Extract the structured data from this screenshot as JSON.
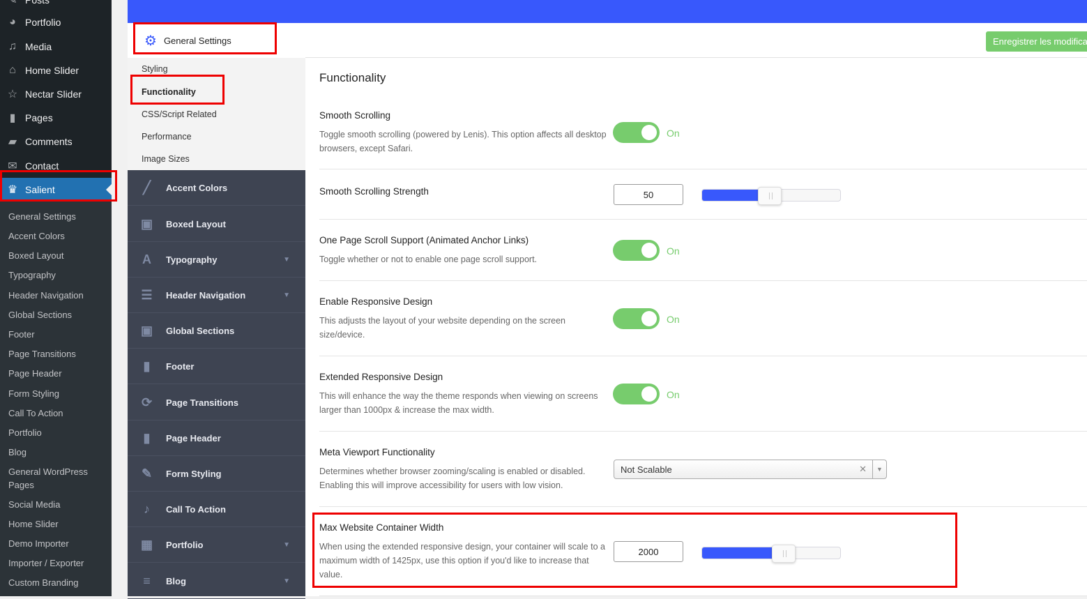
{
  "wp_menu": {
    "items": [
      {
        "label": "Posts",
        "icon": "pin-icon"
      },
      {
        "label": "Portfolio",
        "icon": "palette-icon"
      },
      {
        "label": "Media",
        "icon": "media-icon"
      },
      {
        "label": "Home Slider",
        "icon": "home-icon"
      },
      {
        "label": "Nectar Slider",
        "icon": "star-icon"
      },
      {
        "label": "Pages",
        "icon": "pages-icon"
      },
      {
        "label": "Comments",
        "icon": "comment-icon"
      },
      {
        "label": "Contact",
        "icon": "mail-icon"
      },
      {
        "label": "Salient",
        "icon": "crown-icon",
        "active": true
      }
    ],
    "submenu": [
      "General Settings",
      "Accent Colors",
      "Boxed Layout",
      "Typography",
      "Header Navigation",
      "Global Sections",
      "Footer",
      "Page Transitions",
      "Page Header",
      "Form Styling",
      "Call To Action",
      "Portfolio",
      "Blog",
      "General WordPress Pages",
      "Social Media",
      "Home Slider",
      "Demo Importer",
      "Importer / Exporter",
      "Custom Branding"
    ]
  },
  "options_panel": {
    "section_header": "General Settings",
    "section_sub": [
      "Styling",
      "Functionality",
      "CSS/Script Related",
      "Performance",
      "Image Sizes"
    ],
    "active_sub": "Functionality",
    "nav": [
      {
        "label": "Accent Colors",
        "icon": "brush-icon"
      },
      {
        "label": "Boxed Layout",
        "icon": "layout-icon"
      },
      {
        "label": "Typography",
        "icon": "font-icon",
        "expandable": true
      },
      {
        "label": "Header Navigation",
        "icon": "menu-icon",
        "expandable": true
      },
      {
        "label": "Global Sections",
        "icon": "layout-icon"
      },
      {
        "label": "Footer",
        "icon": "file-icon"
      },
      {
        "label": "Page Transitions",
        "icon": "refresh-icon"
      },
      {
        "label": "Page Header",
        "icon": "file-icon"
      },
      {
        "label": "Form Styling",
        "icon": "edit-icon"
      },
      {
        "label": "Call To Action",
        "icon": "bell-icon"
      },
      {
        "label": "Portfolio",
        "icon": "grid-icon",
        "expandable": true
      },
      {
        "label": "Blog",
        "icon": "list-icon",
        "expandable": true
      }
    ]
  },
  "main": {
    "save_button": "Enregistrer les modifications",
    "title": "Functionality",
    "settings": {
      "smooth_scrolling": {
        "label": "Smooth Scrolling",
        "desc": "Toggle smooth scrolling (powered by Lenis). This option affects all desktop browsers, except Safari.",
        "state": "On"
      },
      "smooth_strength": {
        "label": "Smooth Scrolling Strength",
        "value": "50",
        "slider_fraction": 0.49
      },
      "one_page": {
        "label": "One Page Scroll Support (Animated Anchor Links)",
        "desc": "Toggle whether or not to enable one page scroll support.",
        "state": "On"
      },
      "responsive": {
        "label": "Enable Responsive Design",
        "desc": "This adjusts the layout of your website depending on the screen size/device.",
        "state": "On"
      },
      "ext_responsive": {
        "label": "Extended Responsive Design",
        "desc": "This will enhance the way the theme responds when viewing on screens larger than 1000px & increase the max width.",
        "state": "On"
      },
      "meta_viewport": {
        "label": "Meta Viewport Functionality",
        "desc": "Determines whether browser zooming/scaling is enabled or disabled. Enabling this will improve accessibility for users with low vision.",
        "value": "Not Scalable"
      },
      "max_width": {
        "label": "Max Website Container Width",
        "desc": "When using the extended responsive design, your container will scale to a maximum width of 1425px, use this option if you'd like to increase that value.",
        "value": "2000",
        "slider_fraction": 0.59
      }
    }
  }
}
